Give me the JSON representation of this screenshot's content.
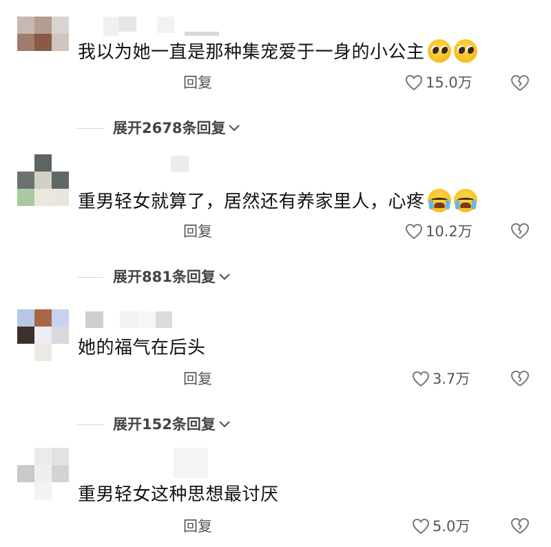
{
  "colors": {
    "text": "#111111",
    "meta": "#555555",
    "accent_emoji": "#f2b20f",
    "tear": "#5fb8f2"
  },
  "comments": [
    {
      "text": "我以为她一直是那种集宠爱于一身的小公主",
      "emoji": "pleading-face",
      "reply_label": "回复",
      "likes": "15.0万",
      "expand_label": "展开2678条回复"
    },
    {
      "text": "重男轻女就算了，居然还有养家里人，心疼",
      "emoji": "loudly-crying-face",
      "reply_label": "回复",
      "likes": "10.2万",
      "expand_label": "展开881条回复"
    },
    {
      "text": "她的福气在后头",
      "emoji": "",
      "reply_label": "回复",
      "likes": "3.7万",
      "expand_label": "展开152条回复"
    },
    {
      "text": "重男轻女这种思想最讨厌",
      "emoji": "",
      "reply_label": "回复",
      "likes": "5.0万",
      "expand_label": ""
    }
  ],
  "icons": {
    "like": "heart-outline-icon",
    "dislike": "broken-heart-icon",
    "expand": "chevron-down-icon"
  }
}
